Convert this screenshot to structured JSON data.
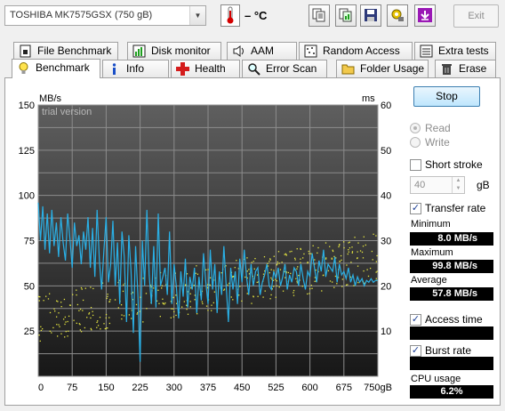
{
  "toolbar": {
    "drive_name": "TOSHIBA MK7575GSX",
    "drive_size": "(750 gB)",
    "temperature": "– °C",
    "exit_label": "Exit",
    "buttons": [
      "copy-text-icon",
      "copy-image-icon",
      "save-icon",
      "options-icon",
      "download-icon"
    ]
  },
  "tabs_top": [
    {
      "label": "File Benchmark",
      "icon": "file-benchmark-icon"
    },
    {
      "label": "Disk monitor",
      "icon": "disk-monitor-icon"
    },
    {
      "label": "AAM",
      "icon": "speaker-icon"
    },
    {
      "label": "Random Access",
      "icon": "random-access-icon"
    },
    {
      "label": "Extra tests",
      "icon": "extra-tests-icon"
    }
  ],
  "tabs_bottom": [
    {
      "label": "Benchmark",
      "icon": "lightbulb-icon",
      "active": true
    },
    {
      "label": "Info",
      "icon": "info-icon"
    },
    {
      "label": "Health",
      "icon": "health-cross-icon"
    },
    {
      "label": "Error Scan",
      "icon": "magnifier-icon"
    },
    {
      "label": "Folder Usage",
      "icon": "folder-icon"
    },
    {
      "label": "Erase",
      "icon": "trash-icon"
    }
  ],
  "chart_data": {
    "type": "line",
    "watermark": "trial version",
    "left_unit": "MB/s",
    "right_unit": "ms",
    "y_left": {
      "min": 0,
      "max": 150,
      "ticks": [
        25,
        50,
        75,
        100,
        125,
        150
      ]
    },
    "y_right": {
      "min": 0,
      "max": 60,
      "ticks": [
        10,
        20,
        30,
        40,
        50,
        60
      ]
    },
    "x": {
      "min": 0,
      "max": 750,
      "unit": "gB",
      "ticks": [
        0,
        75,
        150,
        225,
        300,
        375,
        450,
        525,
        600,
        675,
        750
      ]
    },
    "series": [
      {
        "name": "Transfer rate",
        "color": "#2ab0e6",
        "x": [
          0,
          5,
          10,
          15,
          20,
          25,
          30,
          35,
          40,
          45,
          50,
          55,
          60,
          65,
          70,
          75,
          80,
          85,
          90,
          95,
          100,
          105,
          110,
          115,
          120,
          125,
          130,
          135,
          140,
          145,
          150,
          155,
          160,
          165,
          170,
          175,
          180,
          185,
          190,
          195,
          200,
          205,
          210,
          215,
          220,
          225,
          230,
          235,
          240,
          245,
          250,
          255,
          260,
          265,
          270,
          275,
          280,
          285,
          290,
          295,
          300,
          305,
          310,
          315,
          320,
          325,
          330,
          335,
          340,
          345,
          350,
          355,
          360,
          365,
          370,
          375,
          380,
          385,
          390,
          395,
          400,
          405,
          410,
          415,
          420,
          425,
          430,
          435,
          440,
          445,
          450,
          455,
          460,
          465,
          470,
          475,
          480,
          485,
          490,
          495,
          500,
          505,
          510,
          515,
          520,
          525,
          530,
          535,
          540,
          545,
          550,
          555,
          560,
          565,
          570,
          575,
          580,
          585,
          590,
          595,
          600,
          605,
          610,
          615,
          620,
          625,
          630,
          635,
          640,
          645,
          650,
          655,
          660,
          665,
          670,
          675,
          680,
          685,
          690,
          695,
          700,
          705,
          710,
          715,
          720,
          725,
          730,
          735,
          740,
          745,
          750
        ],
        "values": [
          96,
          75,
          94,
          70,
          90,
          68,
          92,
          72,
          85,
          66,
          88,
          74,
          64,
          90,
          76,
          60,
          85,
          72,
          78,
          62,
          80,
          70,
          88,
          60,
          82,
          55,
          92,
          64,
          48,
          70,
          88,
          52,
          62,
          86,
          50,
          74,
          40,
          80,
          66,
          30,
          78,
          58,
          24,
          72,
          45,
          8,
          75,
          50,
          92,
          56,
          40,
          72,
          38,
          90,
          50,
          55,
          60,
          45,
          80,
          40,
          62,
          50,
          32,
          58,
          44,
          65,
          38,
          55,
          48,
          60,
          35,
          55,
          42,
          68,
          52,
          40,
          70,
          48,
          62,
          35,
          58,
          45,
          72,
          50,
          30,
          60,
          48,
          58,
          40,
          65,
          52,
          70,
          55,
          45,
          62,
          50,
          58,
          60,
          45,
          52,
          56,
          62,
          50,
          48,
          58,
          54,
          60,
          50,
          55,
          62,
          48,
          56,
          52,
          60,
          58,
          50,
          62,
          54,
          48,
          58,
          55,
          68,
          60,
          52,
          64,
          58,
          70,
          55,
          62,
          60,
          58,
          66,
          52,
          62,
          56,
          58,
          54,
          60,
          52,
          56,
          50,
          55,
          52,
          54,
          50,
          53,
          52,
          54,
          52,
          53,
          53
        ]
      }
    ],
    "access_time_dot_color": "#e8e840"
  },
  "controls": {
    "stop_label": "Stop",
    "read_label": "Read",
    "write_label": "Write",
    "short_stroke_label": "Short stroke",
    "stroke_value": "40",
    "stroke_unit": "gB",
    "transfer_rate_label": "Transfer rate",
    "minimum_label": "Minimum",
    "minimum_value": "8.0 MB/s",
    "maximum_label": "Maximum",
    "maximum_value": "99.8 MB/s",
    "average_label": "Average",
    "average_value": "57.8 MB/s",
    "access_time_label": "Access time",
    "burst_rate_label": "Burst rate",
    "cpu_usage_label": "CPU usage",
    "cpu_usage_value": "6.2%"
  }
}
